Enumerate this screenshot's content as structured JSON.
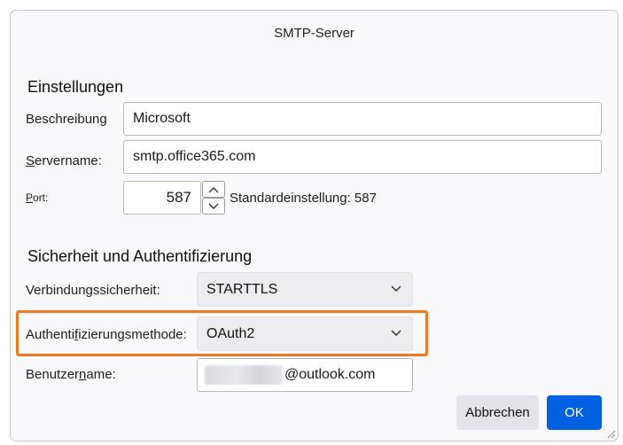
{
  "dialog": {
    "title": "SMTP-Server"
  },
  "settings": {
    "heading": "Einstellungen",
    "description": {
      "label": "Beschreibung",
      "value": "Microsoft"
    },
    "servername": {
      "label_first": "S",
      "label_rest": "ervername:",
      "value": "smtp.office365.com"
    },
    "port": {
      "label_first": "P",
      "label_rest": "ort:",
      "value": "587",
      "default_text": "Standardeinstellung: 587"
    }
  },
  "security": {
    "heading": "Sicherheit und Authentifizierung",
    "connection_security": {
      "label": "Verbindungssicherheit:",
      "value": "STARTTLS"
    },
    "auth_method": {
      "label_before": "Authenti",
      "label_underlined": "f",
      "label_after": "izierungsmethode:",
      "value": "OAuth2"
    },
    "username": {
      "label_before": "Benutzer",
      "label_underlined": "n",
      "label_after": "ame:",
      "value_suffix": "@outlook.com"
    }
  },
  "buttons": {
    "cancel": "Abbrechen",
    "ok": "OK"
  },
  "colors": {
    "highlight": "#f07a1d",
    "ok_button": "#0061e0"
  },
  "icons": {
    "spinner_up": "chevron-up-icon",
    "spinner_down": "chevron-down-icon",
    "select": "chevron-down-icon",
    "resize": "resize-grip-icon"
  }
}
